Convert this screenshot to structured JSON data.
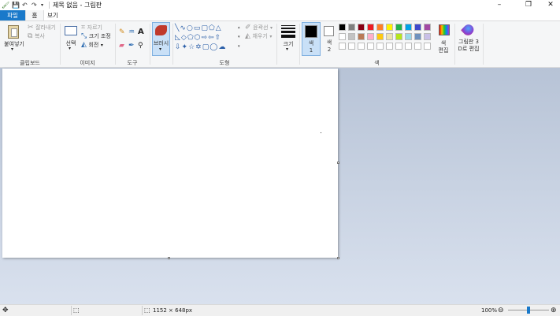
{
  "titlebar": {
    "title": "제목 없음 - 그림판",
    "minimize": "–",
    "maximize": "❐",
    "close": "✕"
  },
  "tabs": {
    "file": "파일",
    "home": "홈",
    "view": "보기"
  },
  "clipboard": {
    "paste": "붙여넣기",
    "cut": "잘라내기",
    "copy": "복사",
    "label": "클립보드"
  },
  "image": {
    "select": "선택",
    "crop": "자르기",
    "resize": "크기 조정",
    "rotate": "회전",
    "label": "이미지"
  },
  "tools": {
    "label": "도구"
  },
  "brushes": {
    "label": "브러시"
  },
  "shapes": {
    "outline": "윤곽선",
    "fill": "채우기",
    "label": "도형"
  },
  "size": {
    "label": "크기"
  },
  "colors": {
    "color1": "색\n1",
    "color2": "색\n2",
    "edit_colors": "색\n편집",
    "label": "색",
    "color1_value": "#000000",
    "color2_value": "#ffffff",
    "palette_row1": [
      "#000000",
      "#7f7f7f",
      "#880015",
      "#ed1c24",
      "#ff7f27",
      "#fff200",
      "#22b14c",
      "#00a2e8",
      "#3f48cc",
      "#a349a4"
    ],
    "palette_row2": [
      "#ffffff",
      "#c3c3c3",
      "#b97a57",
      "#ffaec9",
      "#ffc90e",
      "#efe4b0",
      "#b5e61d",
      "#99d9ea",
      "#7092be",
      "#c8bfe7"
    ],
    "palette_row3": [
      "#ffffff",
      "#ffffff",
      "#ffffff",
      "#ffffff",
      "#ffffff",
      "#ffffff",
      "#ffffff",
      "#ffffff",
      "#ffffff",
      "#ffffff"
    ]
  },
  "paint3d": {
    "label": "그림판 3\nD로 편집"
  },
  "status": {
    "image_size": "1152 × 648px",
    "zoom": "100%",
    "zoom_level": 1.0
  }
}
